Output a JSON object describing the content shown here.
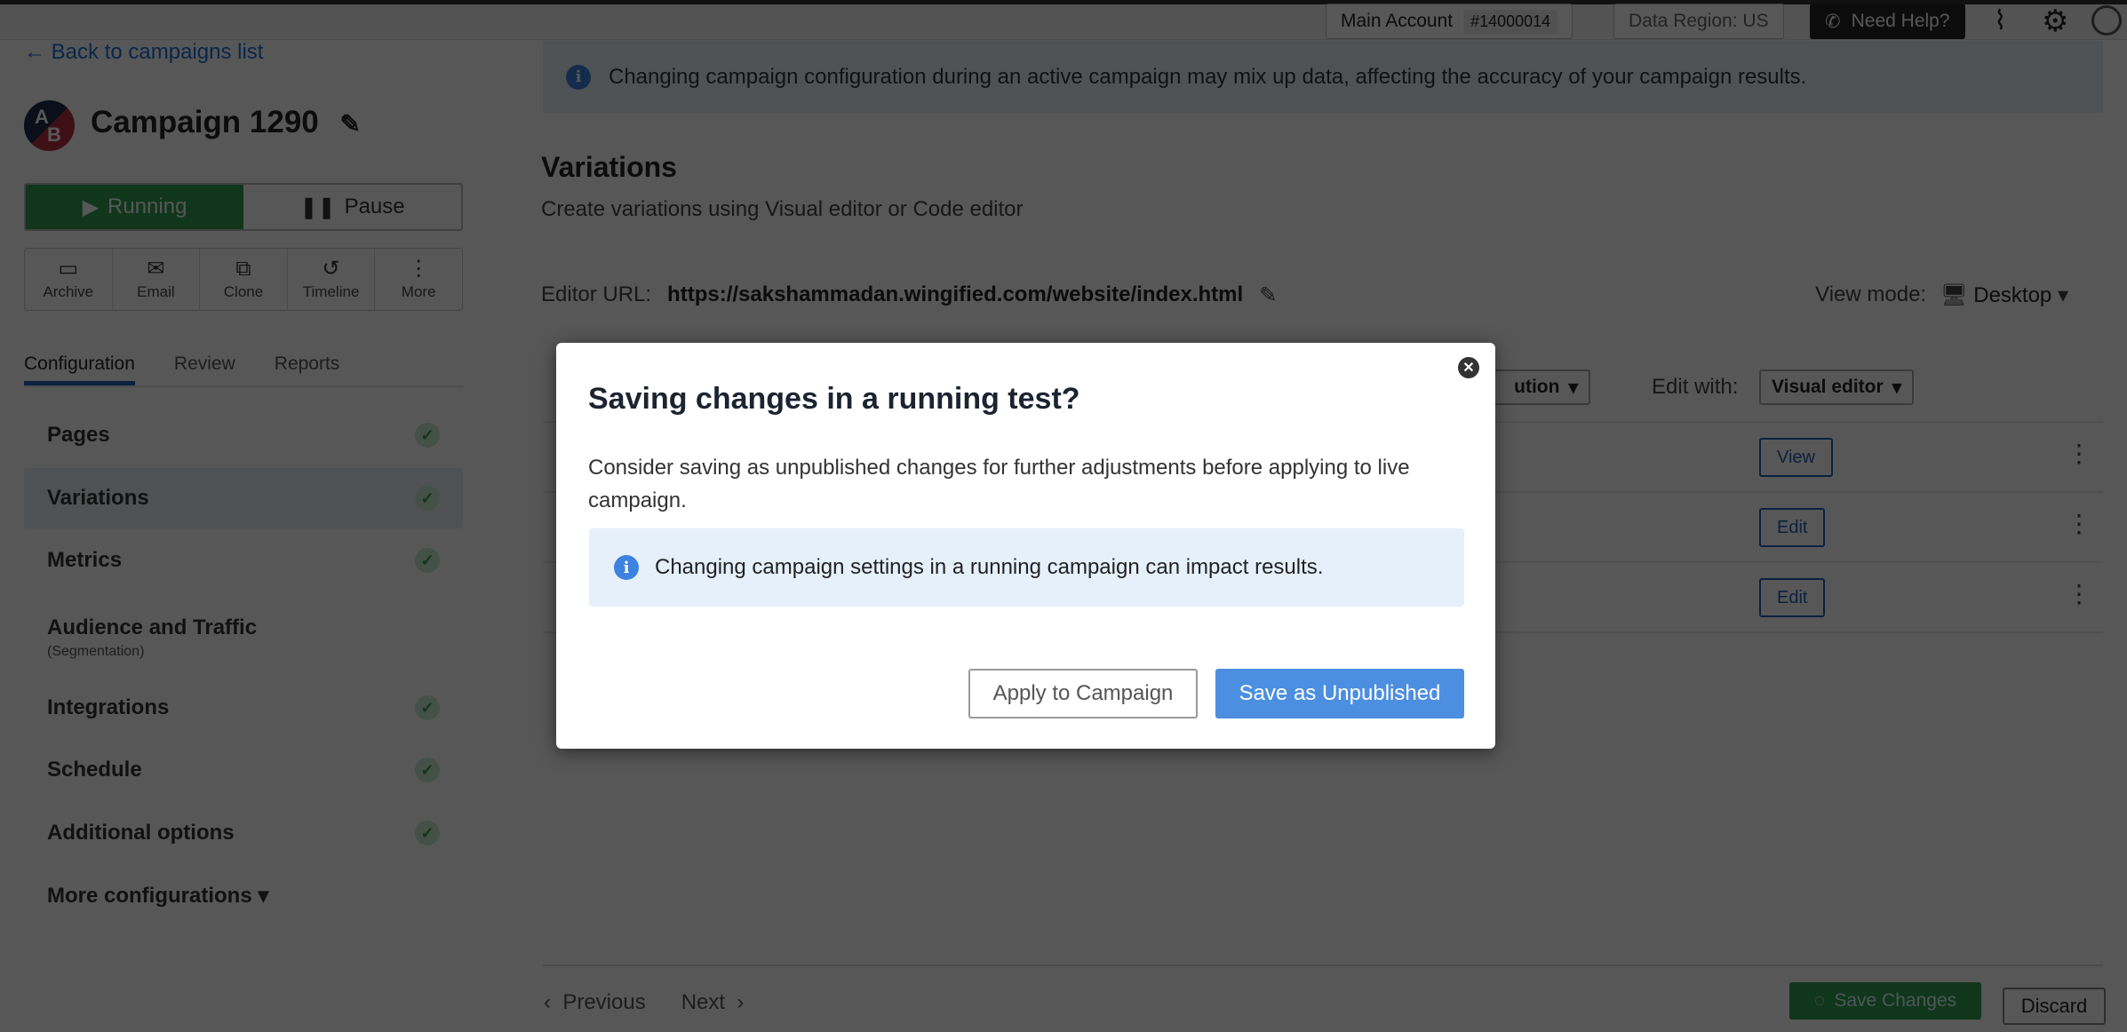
{
  "header": {
    "account_label": "Main Account",
    "account_id": "#14000014",
    "data_region": "Data Region: US",
    "help": "Need Help?",
    "icons": [
      "activity-icon",
      "gear-icon",
      "user-avatar-icon"
    ]
  },
  "sidebar": {
    "back_link": "Back to campaigns list",
    "avatar_letters": "AB",
    "campaign_title": "Campaign 1290",
    "status": {
      "running": "Running",
      "pause": "Pause"
    },
    "actions": [
      {
        "label": "Archive",
        "icon": "archive-icon"
      },
      {
        "label": "Email",
        "icon": "email-icon"
      },
      {
        "label": "Clone",
        "icon": "clone-icon"
      },
      {
        "label": "Timeline",
        "icon": "history-icon"
      },
      {
        "label": "More",
        "icon": "more-vertical-icon"
      }
    ],
    "tabs": [
      "Configuration",
      "Review",
      "Reports"
    ],
    "items": [
      {
        "label": "Pages",
        "done": true
      },
      {
        "label": "Variations",
        "done": true,
        "selected": true
      },
      {
        "label": "Metrics",
        "done": true
      },
      {
        "label": "Audience and Traffic",
        "sub": "(Segmentation)",
        "done": false
      },
      {
        "label": "Integrations",
        "done": true
      },
      {
        "label": "Schedule",
        "done": true
      },
      {
        "label": "Additional options",
        "done": true
      },
      {
        "label": "More configurations ▾",
        "done": false
      }
    ]
  },
  "main": {
    "banner": "Changing campaign configuration during an active campaign may mix up data, affecting the accuracy of your campaign results.",
    "title": "Variations",
    "subtitle": "Create variations using Visual editor or Code editor",
    "editor_url_label": "Editor URL:",
    "editor_url": "https://sakshammadan.wingified.com/website/index.html",
    "view_mode_label": "View mode:",
    "view_mode": "Desktop",
    "distribution_select": "ution",
    "edit_with_label": "Edit with:",
    "edit_with": "Visual editor",
    "rows": [
      {
        "action": "View"
      },
      {
        "action": "Edit"
      },
      {
        "action": "Edit"
      }
    ],
    "previous": "Previous",
    "next": "Next",
    "save_changes": "Save Changes",
    "discard": "Discard"
  },
  "modal": {
    "title": "Saving changes in a running test?",
    "body": "Consider saving as unpublished changes for further adjustments before applying to live campaign.",
    "info": "Changing campaign settings in a running campaign can impact results.",
    "apply": "Apply to Campaign",
    "save": "Save as Unpublished"
  },
  "colors": {
    "accent": "#4c8fe0",
    "running": "#2f9e4f",
    "info_bg": "#e6f0fb"
  }
}
